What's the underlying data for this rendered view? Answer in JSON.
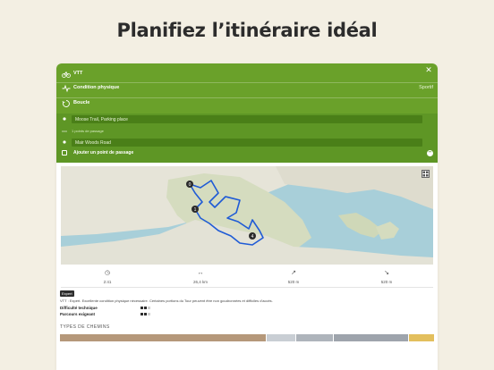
{
  "headline": "Planifiez l’itinéraire idéal",
  "panel": {
    "sport": "VTT",
    "fitness_label": "Condition physique",
    "fitness_value": "Sportif",
    "loop_label": "Boucle",
    "start": "Moose Trail, Parking place",
    "waypoints": "1 points de passage",
    "end": "Mair Woods Road",
    "add_waypoint": "Ajouter un point de passage"
  },
  "map": {
    "markers": [
      "0",
      "1",
      "4"
    ],
    "route_color": "#1f5bd6",
    "water_color": "#a8cfd9",
    "land_color": "#e3e2d6",
    "forest_color": "#cfd8b8"
  },
  "stats": [
    {
      "icon": "clock-icon",
      "value": "2:41"
    },
    {
      "icon": "distance-icon",
      "value": "26,4 km"
    },
    {
      "icon": "ascent-icon",
      "value": "520 m"
    },
    {
      "icon": "descent-icon",
      "value": "520 m"
    }
  ],
  "difficulty": {
    "badge": "Expert",
    "description": "VTT : Expert. Excellente condition physique nécessaire. Certaines portions du Tour peuvent être non goudronnées et difficiles d'accès.",
    "technical_label": "Difficulté technique",
    "technical_level": 2,
    "fitness_label": "Parcours exigeant",
    "fitness_level": 2,
    "max_level": 3
  },
  "path_types": {
    "title": "TYPES DE CHEMINS",
    "segments": [
      {
        "color": "#b5987a",
        "share": 0.55
      },
      {
        "color": "#c9ced4",
        "share": 0.08
      },
      {
        "color": "#aeb4bb",
        "share": 0.1
      },
      {
        "color": "#9ea4ac",
        "share": 0.2
      },
      {
        "color": "#e3bf5d",
        "share": 0.07
      }
    ]
  }
}
